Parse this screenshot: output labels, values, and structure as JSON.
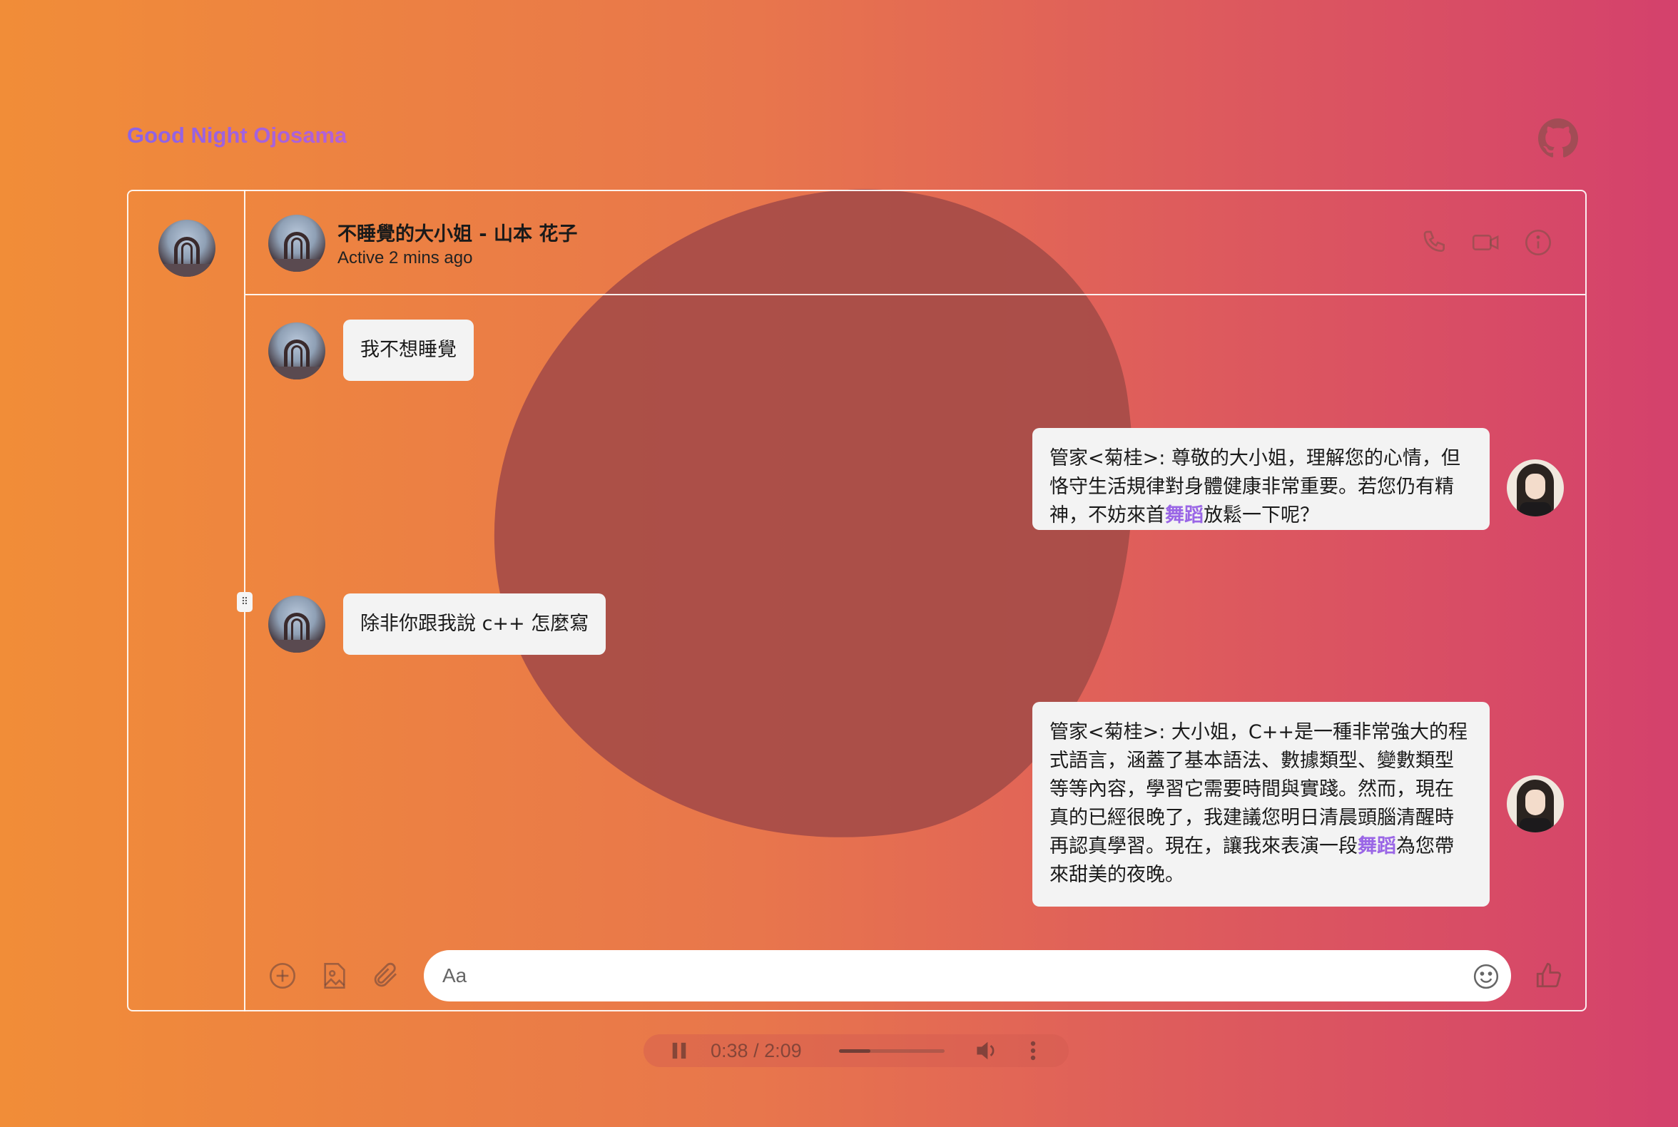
{
  "app": {
    "title": "Good Night Ojosama"
  },
  "header": {
    "name": "不睡覺的大小姐 - 山本 花子",
    "status": "Active 2 mins ago",
    "icons": [
      "phone-icon",
      "video-icon",
      "info-icon"
    ]
  },
  "messages": [
    {
      "from": "user",
      "text": "我不想睡覺"
    },
    {
      "from": "bot",
      "lines": [
        {
          "text": "管家<菊桂>: 尊敬的大小姐，理解您的心情，但"
        },
        {
          "text": "恪守生活規律對身體健康非常重要。若您仍有精"
        },
        {
          "pre": "神，不妨來首",
          "hl": "舞蹈",
          "post": "放鬆一下呢？"
        }
      ]
    },
    {
      "from": "user",
      "text": "除非你跟我說 c++ 怎麼寫"
    },
    {
      "from": "bot",
      "lines": [
        {
          "text": "管家<菊桂>: 大小姐，C++是一種非常強大的程"
        },
        {
          "text": "式語言，涵蓋了基本語法、數據類型、變數類型"
        },
        {
          "text": "等等內容，學習它需要時間與實踐。然而，現在"
        },
        {
          "text": "真的已經很晚了，我建議您明日清晨頭腦清醒時"
        },
        {
          "pre": "再認真學習。現在，讓我來表演一段",
          "hl": "舞蹈",
          "post": "為您帶"
        },
        {
          "text": "來甜美的夜晚。"
        }
      ]
    }
  ],
  "composer": {
    "placeholder": "Aa",
    "icons": [
      "add-circle-icon",
      "image-icon",
      "attach-icon",
      "emoji-icon",
      "thumbs-up-icon"
    ]
  },
  "audio": {
    "current": "0:38",
    "separator": "/",
    "duration": "2:09",
    "progress": 0.3
  },
  "colors": {
    "accent": "#9a66e6",
    "bubble": "#f3f3f3",
    "bg_left": "#f18d38",
    "bg_right": "#d4416c"
  }
}
